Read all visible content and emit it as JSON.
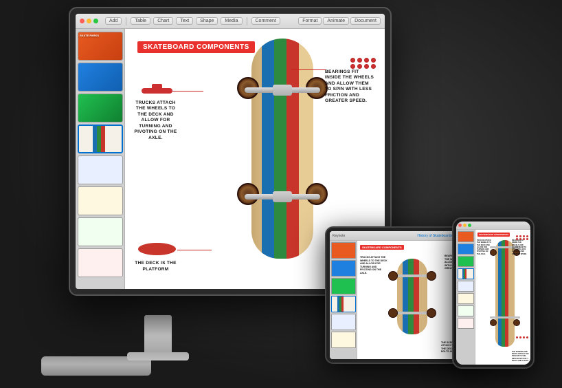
{
  "app": {
    "title": "Keynote — skateboard components",
    "toolbar": {
      "buttons": [
        "Add",
        "Table",
        "Chart",
        "Text",
        "Shape",
        "Media",
        "Comment",
        "Format",
        "Animate",
        "Document"
      ]
    }
  },
  "slide": {
    "title": "skateboard components",
    "annotations": {
      "trucks": "TRUCKS ATTACH THE WHEELS TO THE DECK AND ALLOW FOR TURNING AND PIVOTING ON THE AXLE.",
      "bearings": "BEARINGS FIT INSIDE THE WHEELS AND ALLOW THEM TO SPIN WITH LESS FRICTION AND GREATER SPEED.",
      "screws": "THE SCREWS AND BOLTS ATTACH THE TRUCKS TO THE DECK IN SETS OF 4 BOLTS AND 4 NUTS.",
      "deck": "THE DECK IS THE PLATFORM"
    }
  },
  "devices": {
    "tablet": {
      "title": "History of Skateboards",
      "slide_title": "skateboard components"
    },
    "phone": {
      "slide_title": "skateboard components"
    }
  },
  "thumbnails": [
    {
      "id": 1,
      "label": "Thumb 1"
    },
    {
      "id": 2,
      "label": "Thumb 2"
    },
    {
      "id": 3,
      "label": "Thumb 3"
    },
    {
      "id": 4,
      "label": "Thumb 4 - active"
    },
    {
      "id": 5,
      "label": "Thumb 5"
    },
    {
      "id": 6,
      "label": "Thumb 6"
    },
    {
      "id": 7,
      "label": "Thumb 7"
    },
    {
      "id": 8,
      "label": "Thumb 8"
    }
  ]
}
